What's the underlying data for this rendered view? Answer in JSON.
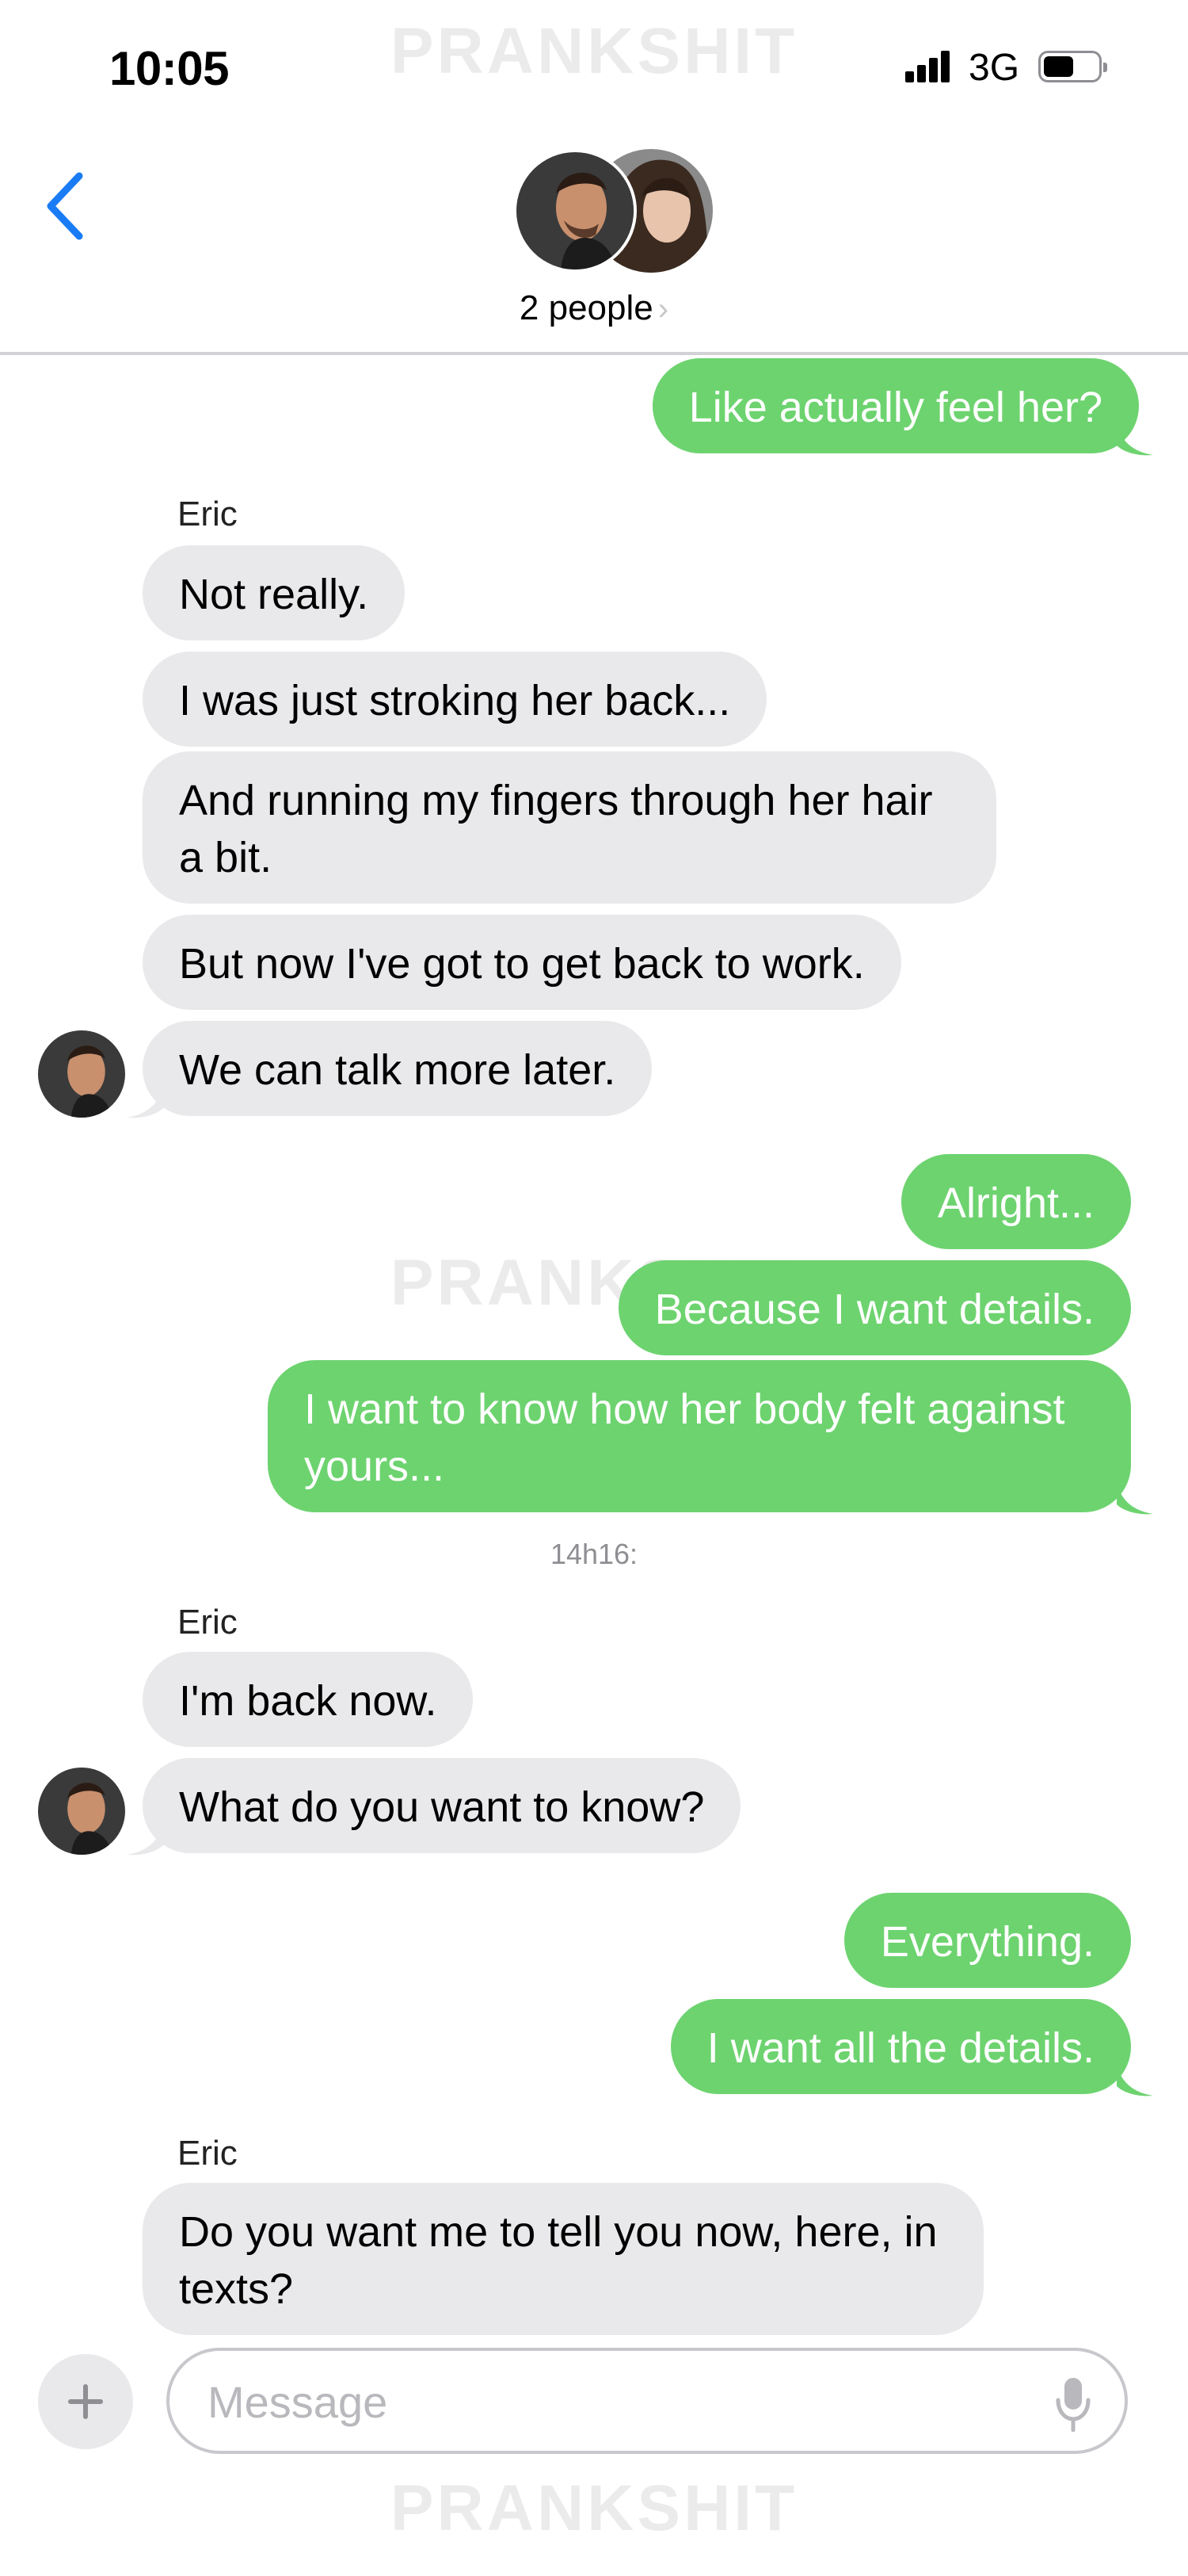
{
  "status_bar": {
    "time": "10:05",
    "network": "3G",
    "battery_level": 0.55
  },
  "watermark": "PRANKSHIT",
  "header": {
    "participants_label": "2 people"
  },
  "conversation": {
    "m1": "Like actually feel her?",
    "sender1": "Eric",
    "m2": "Not really.",
    "m3": "I was just stroking her back...",
    "m4": "And running my fingers through her hair a bit.",
    "m5": "But now I've got to get back to work.",
    "m6": "We can talk more later.",
    "m7": "Alright...",
    "m8": "Because I want details.",
    "m9": "I want to know how her body felt against yours...",
    "timestamp": "14h16:",
    "sender2": "Eric",
    "m10": "I'm back now.",
    "m11": "What do you want to know?",
    "m12": "Everything.",
    "m13": "I want all the details.",
    "sender3": "Eric",
    "m14": "Do you want me to tell you now, here, in texts?"
  },
  "composer": {
    "placeholder": "Message"
  },
  "colors": {
    "sent_bubble": "#6dd36f",
    "received_bubble": "#e9e9eb",
    "accent": "#1a7cf4"
  },
  "icons": [
    "back-chevron-icon",
    "plus-icon",
    "microphone-icon",
    "signal-icon",
    "battery-icon"
  ]
}
